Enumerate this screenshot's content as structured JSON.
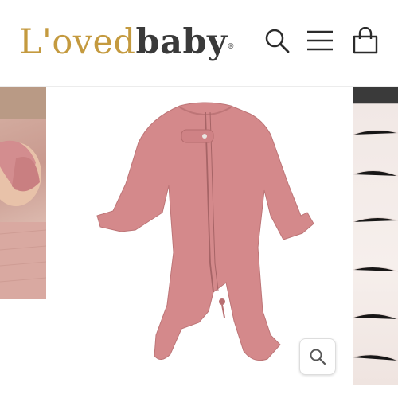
{
  "brand": {
    "logo_part1": "L'oved",
    "logo_part2": "baby",
    "registered_mark": "®",
    "gold_color": "#c49a3f",
    "dark_color": "#3a3a3a"
  },
  "header_icons": [
    "search-icon",
    "menu-icon",
    "shopping-bag-icon"
  ],
  "gallery": {
    "product_color": "#d4898b",
    "zoom_icon": "magnifier-icon"
  }
}
